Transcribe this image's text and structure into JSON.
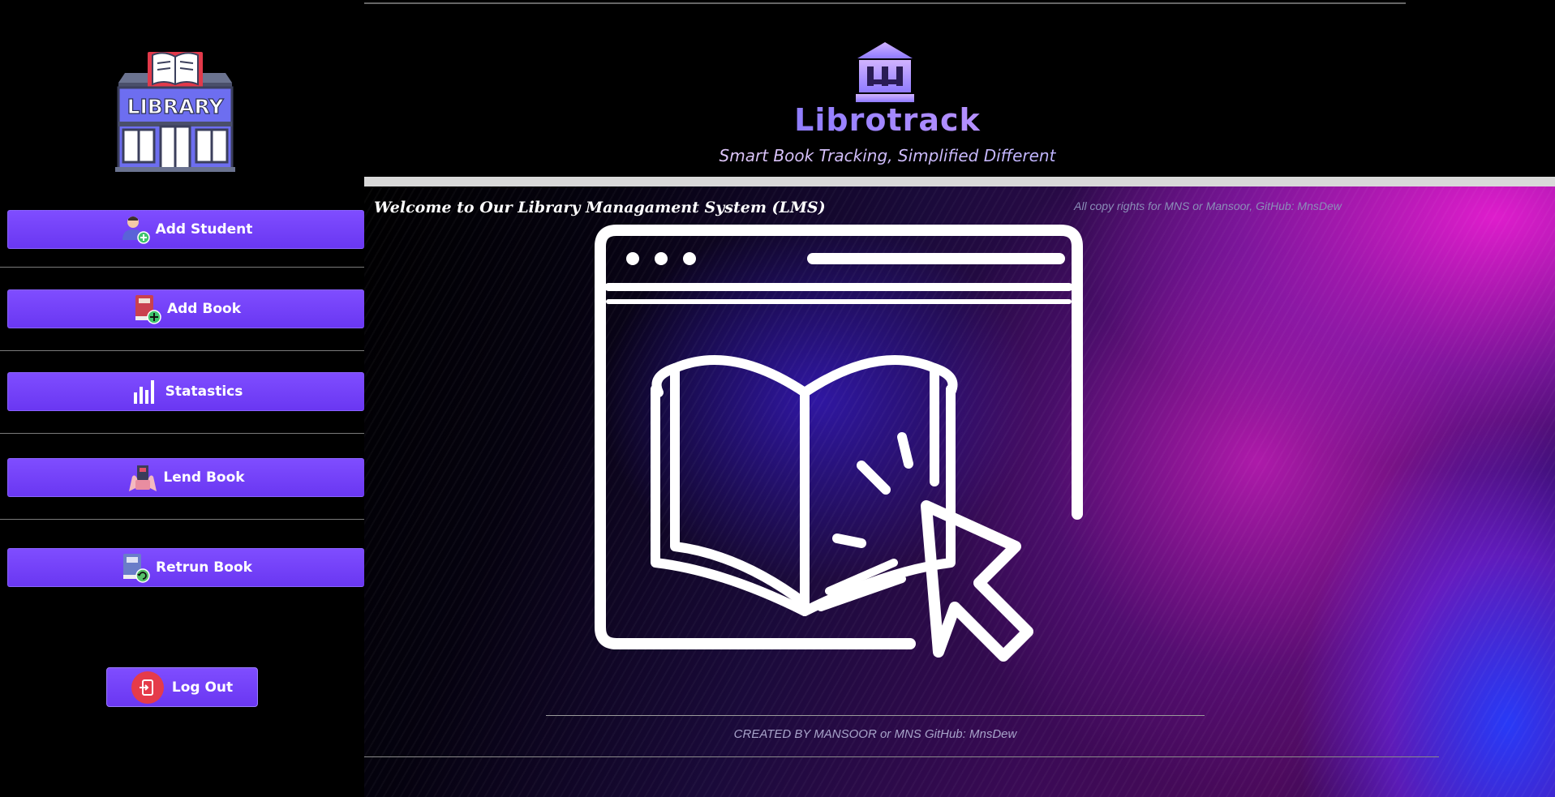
{
  "sidebar": {
    "logo_text": "LIBRARY",
    "buttons": [
      {
        "label": "Add Student",
        "icon": "student-add-icon"
      },
      {
        "label": "Add Book",
        "icon": "book-add-icon"
      },
      {
        "label": "Statastics",
        "icon": "bar-chart-icon"
      },
      {
        "label": "Lend Book",
        "icon": "lend-book-icon"
      },
      {
        "label": "Retrun Book",
        "icon": "return-book-icon"
      }
    ],
    "logout_label": "Log Out"
  },
  "header": {
    "brand": "Librotrack",
    "tagline": "Smart Book Tracking, Simplified Different"
  },
  "main": {
    "welcome": "Welcome to Our Library Managament System (LMS)",
    "copyright": "All copy rights for MNS or Mansoor, GitHub: MnsDew",
    "footer": "CREATED BY MANSOOR or MNS GitHub: MnsDew"
  },
  "colors": {
    "button": "#7340ff",
    "background": "#000000",
    "accent_magenta": "#d61fd0"
  }
}
